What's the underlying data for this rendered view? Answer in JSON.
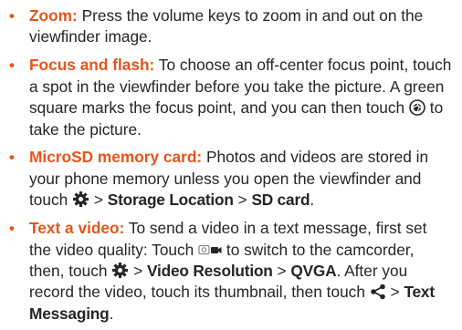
{
  "items": [
    {
      "term": "Zoom:",
      "text": " Press the volume keys to zoom in and out on the viewfinder image."
    },
    {
      "term": "Focus and flash:",
      "text_a": " To choose an off-center focus point, touch a spot in the viewfinder before you take the picture. A green square marks the focus point, and you can then touch ",
      "icon": "shutter-icon",
      "text_b": " to take the picture."
    },
    {
      "term": "MicroSD memory card:",
      "text_a": " Photos and videos are stored in your phone memory unless you open the viewfinder and touch ",
      "icon": "settings-gear-icon",
      "sep1": " > ",
      "ui1": "Storage Location",
      "sep2": " > ",
      "ui2": "SD card",
      "end": "."
    },
    {
      "term": "Text a video:",
      "text_a": " To send a video in a text message, first set the video quality: Touch ",
      "icon1": "camera-camcorder-switch-icon",
      "text_b": " to switch to the camcorder, then, touch ",
      "icon2": "settings-gear-icon",
      "sep1": " > ",
      "ui1": "Video Resolution",
      "sep2": " > ",
      "ui2": "QVGA",
      "text_c": ". After you record the video, touch its thumbnail, then touch ",
      "icon3": "share-icon",
      "sep3": " > ",
      "ui3": "Text Messaging",
      "end": "."
    }
  ],
  "colors": {
    "accent": "#e8541a",
    "text": "#262626"
  },
  "bullet": "•"
}
